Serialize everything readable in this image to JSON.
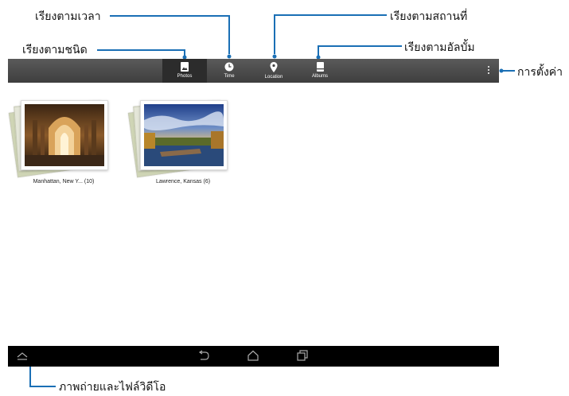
{
  "tabs": [
    {
      "label": "Photos",
      "icon": "photos-icon",
      "active": true
    },
    {
      "label": "Time",
      "icon": "clock-icon",
      "active": false
    },
    {
      "label": "Location",
      "icon": "location-pin-icon",
      "active": false
    },
    {
      "label": "Albums",
      "icon": "albums-icon",
      "active": false
    }
  ],
  "albums": [
    {
      "caption": "Manhattan, New Y... (10)"
    },
    {
      "caption": "Lawrence, Kansas (6)"
    }
  ],
  "callouts": {
    "time": "เรียงตามเวลา",
    "type": "เรียงตามชนิด",
    "location": "เรียงตามสถานที่",
    "albums": "เรียงตามอัลบั้ม",
    "settings": "การตั้งค่า",
    "photos_videos": "ภาพถ่ายและไฟล์วิดีโอ"
  },
  "colors": {
    "callout_line": "#1a6fb5",
    "actionbar": "#4a4a4a",
    "navbar": "#000000"
  }
}
